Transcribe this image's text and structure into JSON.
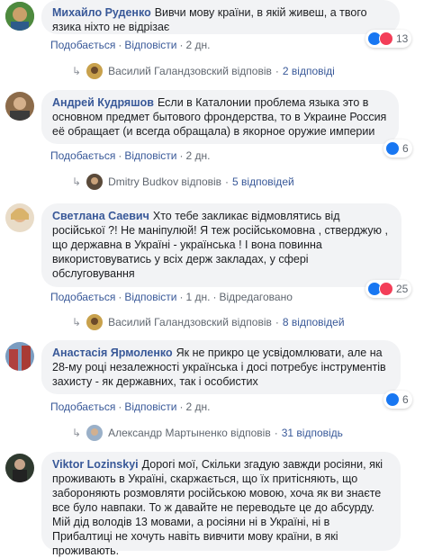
{
  "reaction_colors": {
    "like": "#1877f2",
    "love": "#f33e58"
  },
  "comments": [
    {
      "author": "Михайло Руденко",
      "text": "Вивчи мову країни, в якій живеш, а твого язика ніхто не відрізає",
      "like": "Подобається",
      "reply": "Відповісти",
      "time": "2 дн.",
      "reactions": {
        "types": [
          "like",
          "love"
        ],
        "count": "13"
      },
      "replies": {
        "by": "Василий Галандзовский відповів",
        "count": "2 відповіді"
      }
    },
    {
      "author": "Андрей Кудряшов",
      "text": "Если в Каталонии проблема языка это в основном предмет бытового фрондерства, то в Украине Россия её обращает (и всегда обращала) в якорное оружие империи",
      "like": "Подобається",
      "reply": "Відповісти",
      "time": "2 дн.",
      "reactions": {
        "types": [
          "like"
        ],
        "count": "6"
      },
      "replies": {
        "by": "Dmitry Budkov відповів",
        "count": "5 відповідей"
      }
    },
    {
      "author": "Светлана Саевич",
      "text": "Хто тебе закликає відмовлятись від російської ?! Не маніпулюй! Я теж російськомовна , стверджую , що державна в Україні - українська ! І вона повинна використовуватись у всіх держ закладах, у сфері обслуговування",
      "like": "Подобається",
      "reply": "Відповісти",
      "time": "1 дн.",
      "edited": "Відредаговано",
      "reactions": {
        "types": [
          "like",
          "love"
        ],
        "count": "25"
      },
      "replies": {
        "by": "Василий Галандзовский відповів",
        "count": "8 відповідей"
      }
    },
    {
      "author": "Анастасія Ярмоленко",
      "text": "Як не прикро це усвідомлювати, але на 28-му році незалежності українська і досі потребує інструментів захисту - як державних, так і особистих",
      "like": "Подобається",
      "reply": "Відповісти",
      "time": "2 дн.",
      "reactions": {
        "types": [
          "like"
        ],
        "count": "6"
      },
      "replies": {
        "by": "Александр Мартыненко відповів",
        "count": "31 відповідь"
      }
    },
    {
      "author": "Viktor Lozinskyi",
      "text": "Дорогі мої, Скільки згадую завжди росіяни, які проживають в Україні, скаржається, що їх притісняють, що забороняють розмовляти російською мовою, хоча як ви знаєте все було навпаки. То ж давайте не переводьте це до абсурду. Мій дід володів 13 мовами, а росіяни ні в Україні, ні в Прибалтиці не хочуть навіть вивчити мову країни, в які проживають."
    }
  ]
}
